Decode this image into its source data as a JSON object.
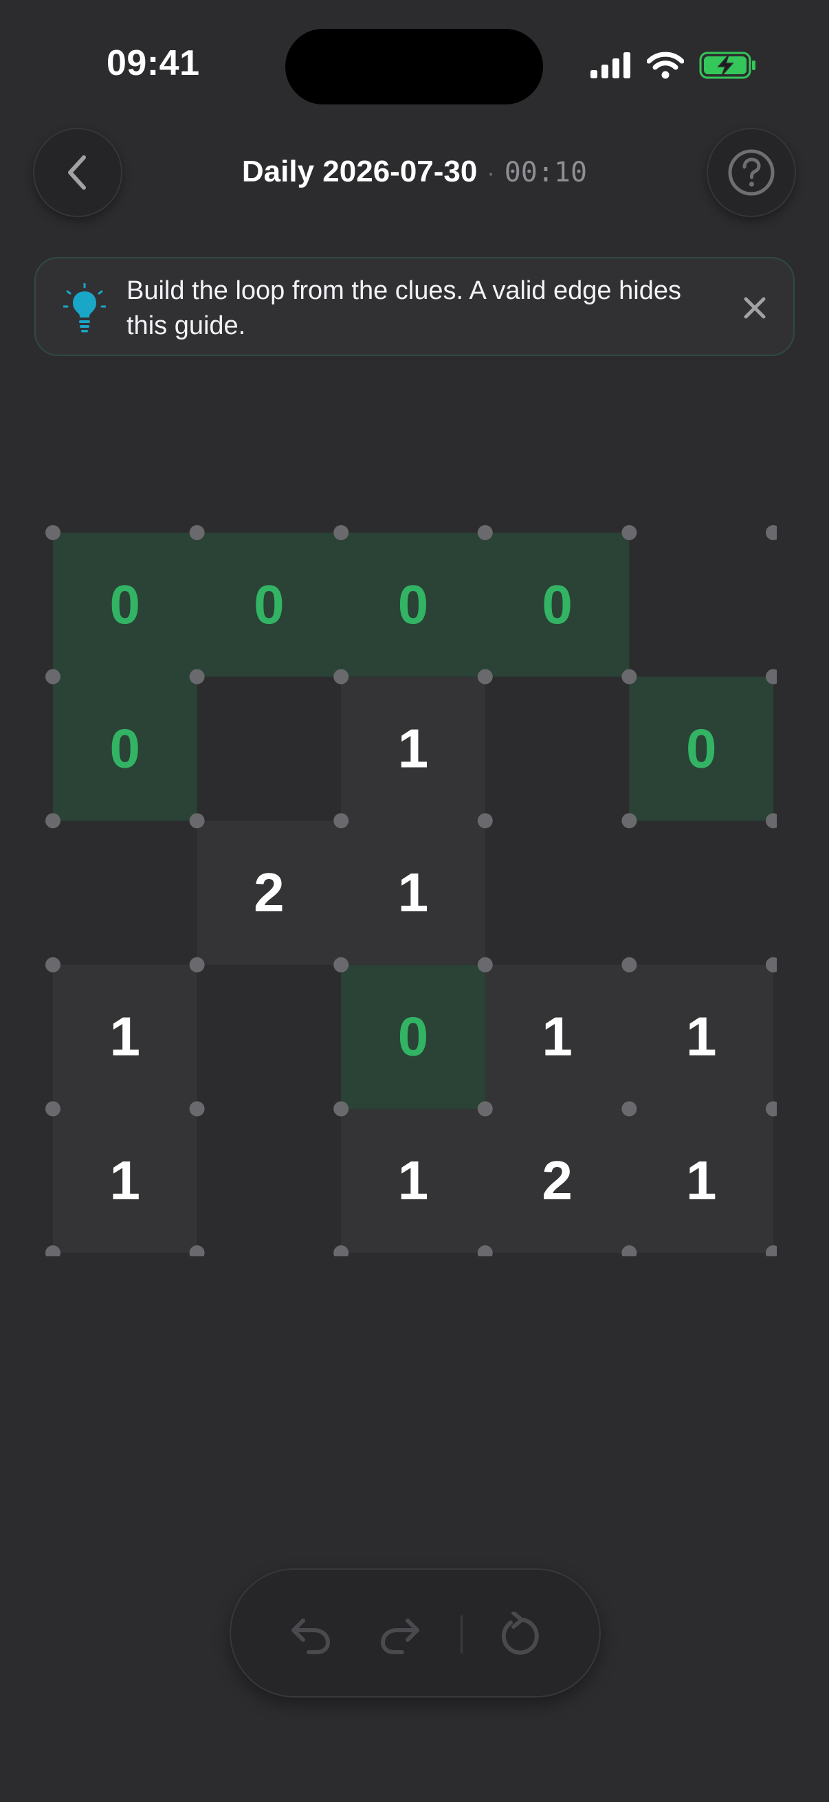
{
  "status": {
    "time": "09:41"
  },
  "header": {
    "title": "Daily 2026-07-30",
    "separator": "·",
    "timer": "00:10"
  },
  "banner": {
    "text": "Build the loop from the clues. A valid edge hides this guide."
  },
  "board": {
    "rows": 5,
    "cols": 5,
    "clues": [
      [
        "0",
        "0",
        "0",
        "0",
        ""
      ],
      [
        "0",
        "",
        "1",
        "",
        "0"
      ],
      [
        "",
        "2",
        "1",
        "",
        ""
      ],
      [
        "1",
        "",
        "0",
        "1",
        "1"
      ],
      [
        "1",
        "",
        "1",
        "2",
        "1"
      ]
    ],
    "satisfied": [
      [
        true,
        true,
        true,
        true,
        false
      ],
      [
        true,
        false,
        false,
        false,
        true
      ],
      [
        false,
        false,
        false,
        false,
        false
      ],
      [
        false,
        false,
        true,
        false,
        false
      ],
      [
        false,
        false,
        false,
        false,
        false
      ]
    ]
  },
  "icons": {
    "back": "chevron-left-icon",
    "help": "question-icon",
    "hint": "lightbulb-icon",
    "close": "close-icon",
    "undo": "undo-icon",
    "redo": "redo-icon",
    "reset": "reset-icon"
  },
  "colors": {
    "background": "#2c2c2e",
    "clue_cell": "#343436",
    "satisfied_cell": "#2b4236",
    "satisfied_text": "#32b464",
    "clue_text": "#ffffff",
    "dot": "#6a6a6e",
    "accent": "#1aa6c6",
    "battery": "#34c759"
  }
}
